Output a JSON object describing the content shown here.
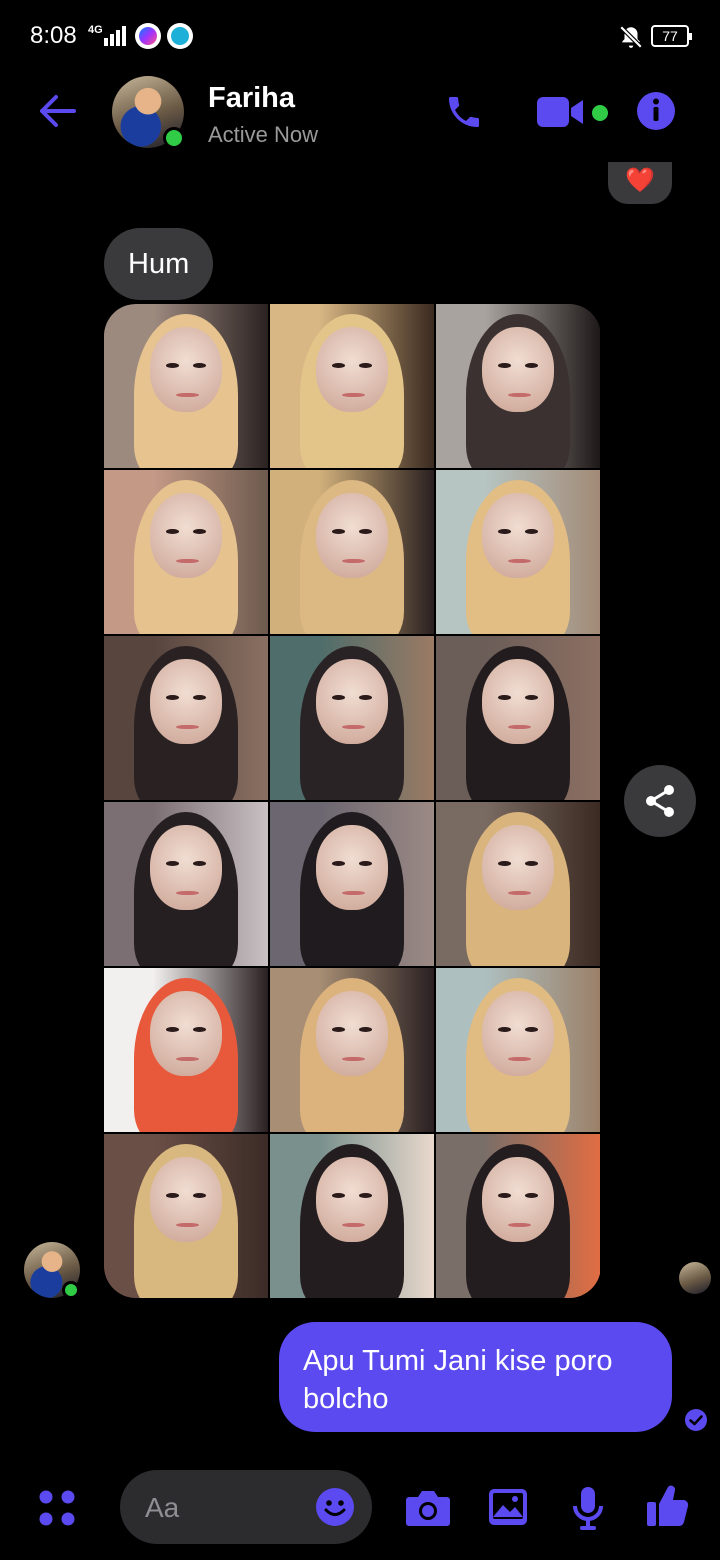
{
  "status_bar": {
    "time": "8:08",
    "network": "4G",
    "battery": "77"
  },
  "header": {
    "contact_name": "Fariha",
    "presence": "Active Now",
    "accent_color": "#5b4af0",
    "online_color": "#31cc46"
  },
  "messages": {
    "reaction": "❤️",
    "incoming_text": "Hum",
    "photo_count": 18,
    "outgoing_text": "Apu Tumi Jani kise poro bolcho"
  },
  "composer": {
    "placeholder": "Aa"
  },
  "icons": [
    "back-arrow-icon",
    "phone-icon",
    "video-camera-icon",
    "info-icon",
    "share-icon",
    "sent-check-icon",
    "apps-icon",
    "emoji-icon",
    "camera-icon",
    "gallery-icon",
    "microphone-icon",
    "thumbs-up-icon"
  ]
}
